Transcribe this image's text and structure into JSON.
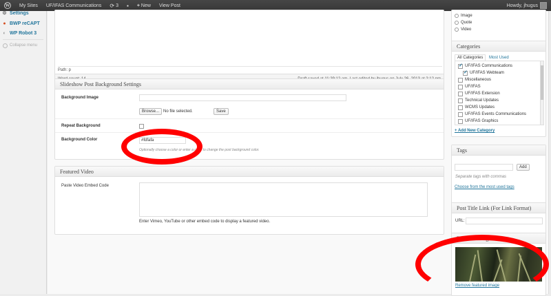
{
  "adminbar": {
    "my_sites": "My Sites",
    "site_name": "UF/IFAS Communications",
    "updates_count": "3",
    "new_label": "New",
    "view_post": "View Post",
    "howdy": "Howdy, jhugus"
  },
  "sidebar": {
    "items": [
      {
        "label": "Settings",
        "icon": "settings-icon"
      },
      {
        "label": "BWP reCAPT",
        "icon": "recaptcha-icon"
      },
      {
        "label": "WP Robot 3",
        "icon": "robot-icon"
      }
    ],
    "collapse_label": "Collapse menu"
  },
  "editor": {
    "path": "Path: p",
    "word_count": "Word count: 14",
    "draft_status": "Draft saved at 11:29:12 am. Last edited by jhugus on July 26, 2013 at 2:12 pm"
  },
  "slideshow": {
    "title": "Slideshow Post Background Settings",
    "background_image_label": "Background Image",
    "browse_label": "Browse...",
    "no_file_label": "No file selected.",
    "save_label": "Save",
    "repeat_label": "Repeat Background",
    "color_label": "Background Color",
    "color_value": "#fdfafa",
    "color_desc": "Optionally choose a color or enter a code to change the post background color."
  },
  "featured_video": {
    "title": "Featured Video",
    "embed_label": "Paste Video Embed Code",
    "embed_desc": "Enter Vimeo, YouTube or other embed code to display a featured video."
  },
  "formats": {
    "options": [
      "Image",
      "Quote",
      "Video"
    ]
  },
  "categories": {
    "title": "Categories",
    "tab_all": "All Categories",
    "tab_used": "Most Used",
    "items": [
      {
        "label": "UF/IFAS Communications",
        "checked": true,
        "child": false
      },
      {
        "label": "UF/IFAS Webteam",
        "checked": true,
        "child": true
      },
      {
        "label": "Miscellaneous",
        "checked": false,
        "child": false
      },
      {
        "label": "UF/IFAS",
        "checked": false,
        "child": false
      },
      {
        "label": "UF/IFAS Extension",
        "checked": false,
        "child": false
      },
      {
        "label": "Technical Updates",
        "checked": false,
        "child": false
      },
      {
        "label": "WCMS Updates",
        "checked": false,
        "child": false
      },
      {
        "label": "UF/IFAS Events Communications",
        "checked": false,
        "child": false
      },
      {
        "label": "UF/IFAS Graphics",
        "checked": false,
        "child": false
      }
    ],
    "add_new": "+ Add New Category"
  },
  "tags": {
    "title": "Tags",
    "add_label": "Add",
    "hint": "Separate tags with commas",
    "choose_link": "Choose from the most used tags"
  },
  "post_title_link": {
    "title": "Post Title Link (For Link Format)",
    "url_label": "URL:"
  },
  "featured_image": {
    "title": "Featured Image",
    "remove_link": "Remove featured image"
  },
  "colors": {
    "annotation_red": "#ff0000",
    "link_blue": "#21759b",
    "adminbar_bg": "#464646"
  }
}
